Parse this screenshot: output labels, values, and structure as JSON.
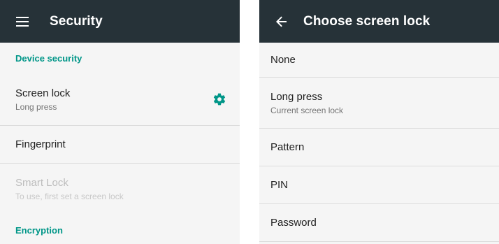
{
  "left": {
    "appbar": {
      "title": "Security",
      "menu_icon": "menu-icon"
    },
    "sections": {
      "device_security": "Device security",
      "encryption": "Encryption"
    },
    "items": [
      {
        "primary": "Screen lock",
        "secondary": "Long press",
        "icon": "gear-icon"
      },
      {
        "primary": "Fingerprint"
      },
      {
        "primary": "Smart Lock",
        "secondary": "To use, first set a screen lock",
        "enabled": false
      }
    ]
  },
  "right": {
    "appbar": {
      "title": "Choose screen lock",
      "back_icon": "arrow-back-icon"
    },
    "items": [
      {
        "primary": "None"
      },
      {
        "primary": "Long press",
        "secondary": "Current screen lock"
      },
      {
        "primary": "Pattern"
      },
      {
        "primary": "PIN"
      },
      {
        "primary": "Password"
      }
    ]
  },
  "colors": {
    "appbar": "#263238",
    "accent": "#009688",
    "background": "#f5f5f5",
    "divider": "#dcdcdc"
  }
}
